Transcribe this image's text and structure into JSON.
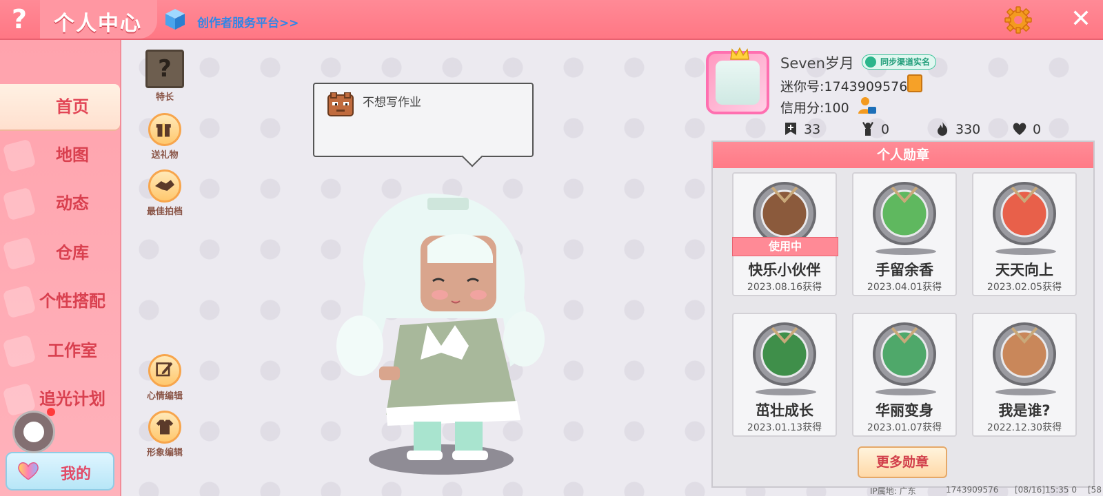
{
  "header": {
    "title": "个人中心",
    "creator_link": "创作者服务平台>>",
    "help": "?",
    "close": "✕"
  },
  "sidebar": {
    "items": [
      {
        "label": "首页",
        "active": true
      },
      {
        "label": "地图",
        "active": false
      },
      {
        "label": "动态",
        "active": false
      },
      {
        "label": "仓库",
        "active": false
      },
      {
        "label": "个性搭配",
        "active": false
      },
      {
        "label": "工作室",
        "active": false
      },
      {
        "label": "追光计划",
        "active": false
      }
    ],
    "my_label": "我的"
  },
  "actions": {
    "specialty": "特长",
    "gift": "送礼物",
    "best_partner": "最佳拍档",
    "mood_edit": "心情编辑",
    "look_edit": "形象编辑"
  },
  "mood": {
    "text": "不想写作业"
  },
  "profile": {
    "username": "Seven岁月",
    "verify_badge": "同步渠道实名",
    "mini_id": "迷你号:1743909576",
    "credit": "信用分:100",
    "stats": {
      "posts": "33",
      "fans": "0",
      "popularity": "330",
      "likes": "0"
    }
  },
  "medals": {
    "header": "个人勋章",
    "in_use_label": "使用中",
    "items": [
      {
        "name": "快乐小伙伴",
        "date": "2023.08.16获得",
        "in_use": true,
        "color": "#8b5a3c"
      },
      {
        "name": "手留余香",
        "date": "2023.04.01获得",
        "in_use": false,
        "color": "#5fb85f"
      },
      {
        "name": "天天向上",
        "date": "2023.02.05获得",
        "in_use": false,
        "color": "#e8604a"
      },
      {
        "name": "茁壮成长",
        "date": "2023.01.13获得",
        "in_use": false,
        "color": "#3f8f4a"
      },
      {
        "name": "华丽变身",
        "date": "2023.01.07获得",
        "in_use": false,
        "color": "#4fa86a"
      },
      {
        "name": "我是谁?",
        "date": "2022.12.30获得",
        "in_use": false,
        "color": "#c9875a"
      }
    ],
    "more_button": "更多勋章"
  },
  "footer": {
    "ip_location": "IP属地: 广东",
    "uid": "1743909576",
    "timestamp": "[08/16]15:35 0",
    "extra": "[58"
  },
  "colors": {
    "accent": "#ff7a86",
    "sidebar": "#ffa9b2",
    "link": "#2f86e8"
  }
}
